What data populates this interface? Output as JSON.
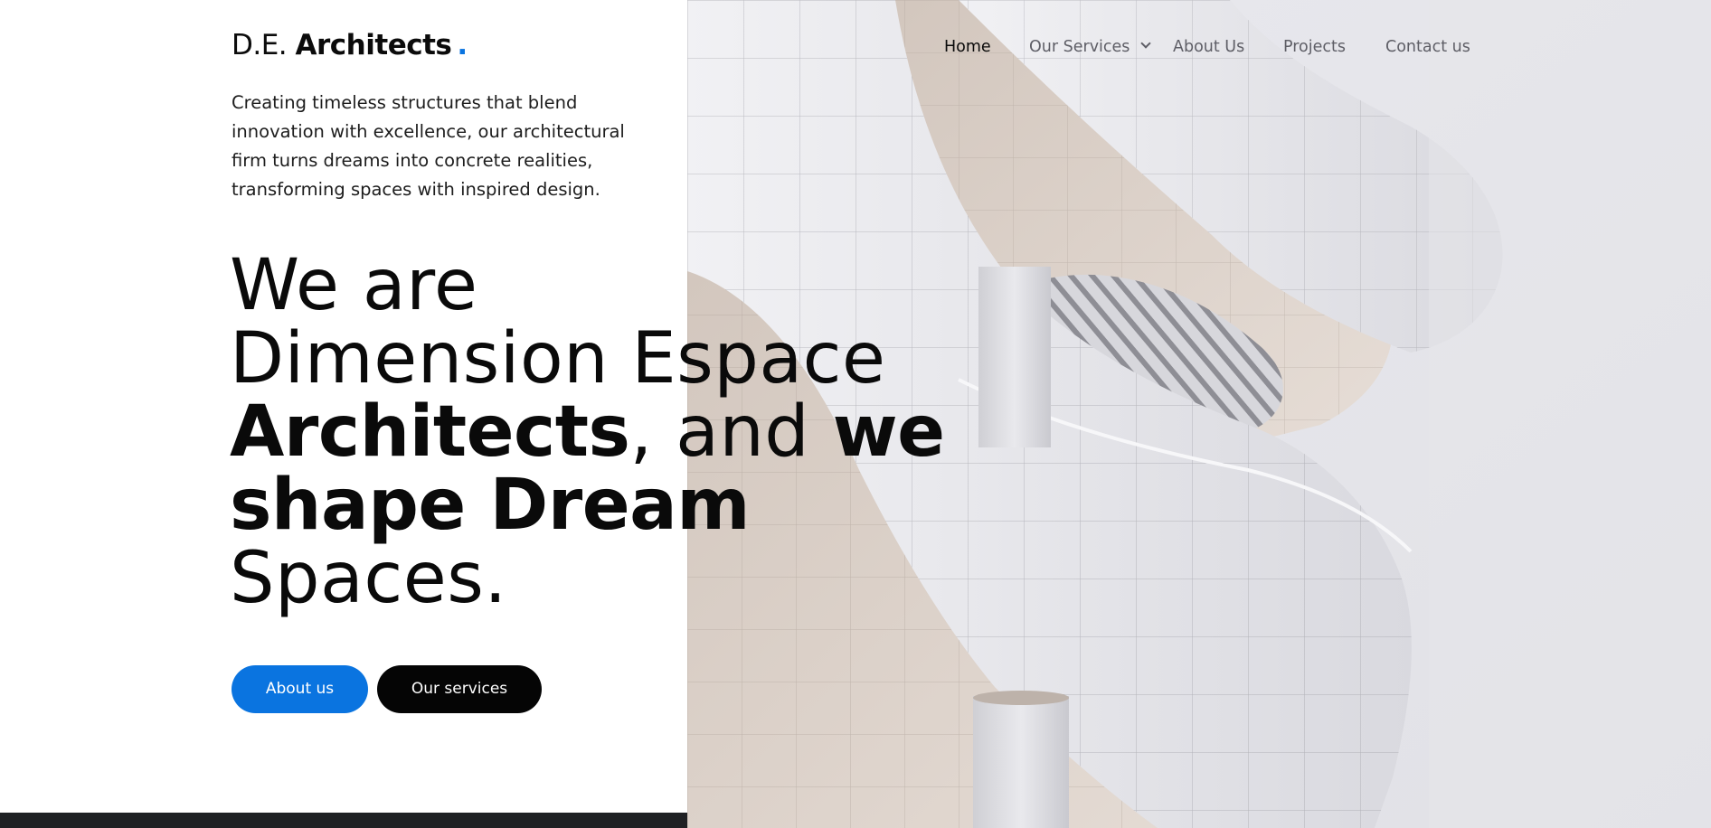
{
  "logo": {
    "part1": "D.E. ",
    "part2": "Architects",
    "dot": "."
  },
  "intro": {
    "text": "Creating timeless structures that blend innovation with excellence, our architectural firm turns dreams into concrete realities, transforming spaces with inspired design."
  },
  "headline": {
    "line1": "We are",
    "line2": "Dimension Espace",
    "line3_bold": "Architects",
    "line3_normal": ", and ",
    "line3_bold2": "we",
    "line4_bold": "shape Dream",
    "line5": "Spaces."
  },
  "buttons": {
    "about": "About us",
    "services": "Our services"
  },
  "nav": {
    "items": [
      {
        "label": "Home",
        "active": true
      },
      {
        "label": "Our Services",
        "dropdown": true
      },
      {
        "label": "About Us"
      },
      {
        "label": "Projects"
      },
      {
        "label": "Contact us"
      }
    ]
  },
  "colors": {
    "accent": "#0a74e0",
    "dark_button": "#050505",
    "bottom_strip": "#1f2124",
    "nav_text": "#5e5e66"
  },
  "icons": {
    "dropdown": "chevron-down-icon"
  }
}
